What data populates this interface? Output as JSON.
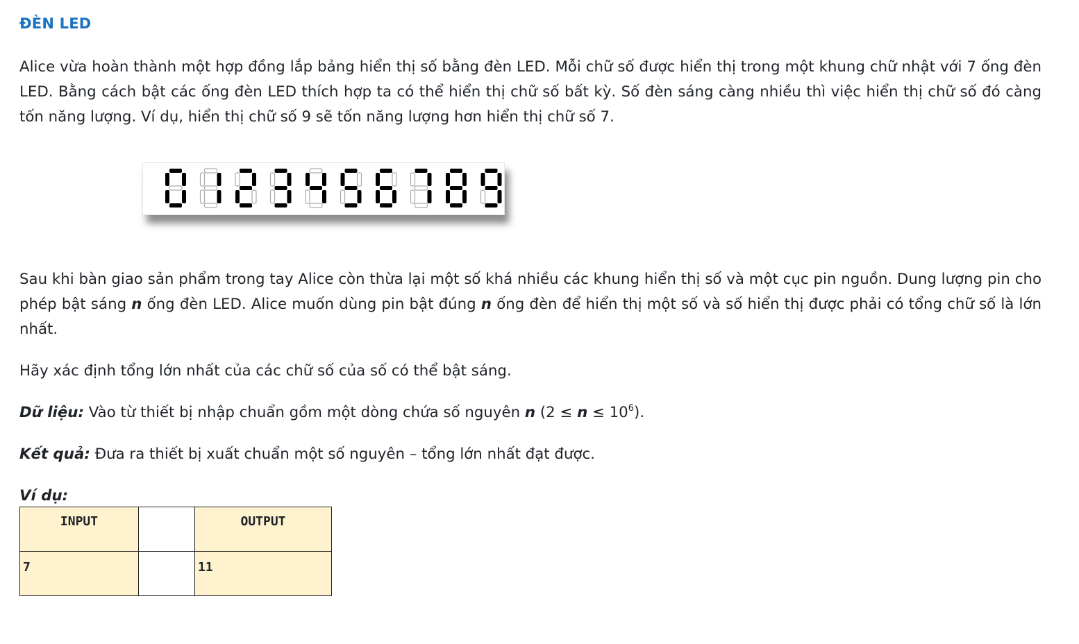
{
  "title": "ĐÈN LED",
  "intro": "Alice vừa hoàn thành một hợp đồng lắp bảng hiển thị số bằng đèn LED. Mỗi chữ số được hiển thị trong một khung chữ nhật với 7 ống đèn LED. Bằng cách bật các ống đèn LED thích hợp ta có thể hiển thị chữ số bất kỳ. Số đèn sáng càng nhiều thì việc hiển thị chữ số đó càng tốn năng lượng. Ví dụ, hiển thị chữ số 9 sẽ tốn năng lượng hơn hiển thị chữ số 7.",
  "led_digits": [
    "0",
    "1",
    "2",
    "3",
    "4",
    "5",
    "6",
    "7",
    "8",
    "9"
  ],
  "para2": {
    "t1": "Sau khi bàn giao sản phẩm trong tay Alice còn thừa lại một số khá nhiều các khung hiển thị số và một cục pin nguồn. Dung lượng pin cho phép bật sáng ",
    "var1": "n",
    "t2": " ống đèn LED. Alice muốn dùng pin bật đúng ",
    "var2": "n",
    "t3": " ống đèn để hiển thị một số và số hiển thị được phải có tổng chữ số là lớn nhất."
  },
  "para3": "Hãy xác định tổng lớn nhất của các chữ số của số có thể bật sáng.",
  "input_section": {
    "label": "Dữ liệu:",
    "t1": " Vào từ thiết bị nhập chuẩn gồm một dòng chứa số nguyên ",
    "var": "n",
    "t2": " (2 ≤ ",
    "var2": "n",
    "t3": " ≤ 10",
    "exp": "6",
    "t4": ")."
  },
  "output_section": {
    "label": "Kết quả:",
    "text": " Đưa ra thiết bị xuất chuẩn một số nguyên – tổng lớn nhất đạt được."
  },
  "example_label": "Ví dụ:",
  "sample_table": {
    "headers": [
      "INPUT",
      "",
      "OUTPUT"
    ],
    "row": [
      "7",
      "",
      "11"
    ]
  },
  "colors": {
    "title": "#1a73c2",
    "table_highlight": "#fff2cf",
    "led_on": "#000000",
    "led_off_outline": "#aaaaaa"
  }
}
